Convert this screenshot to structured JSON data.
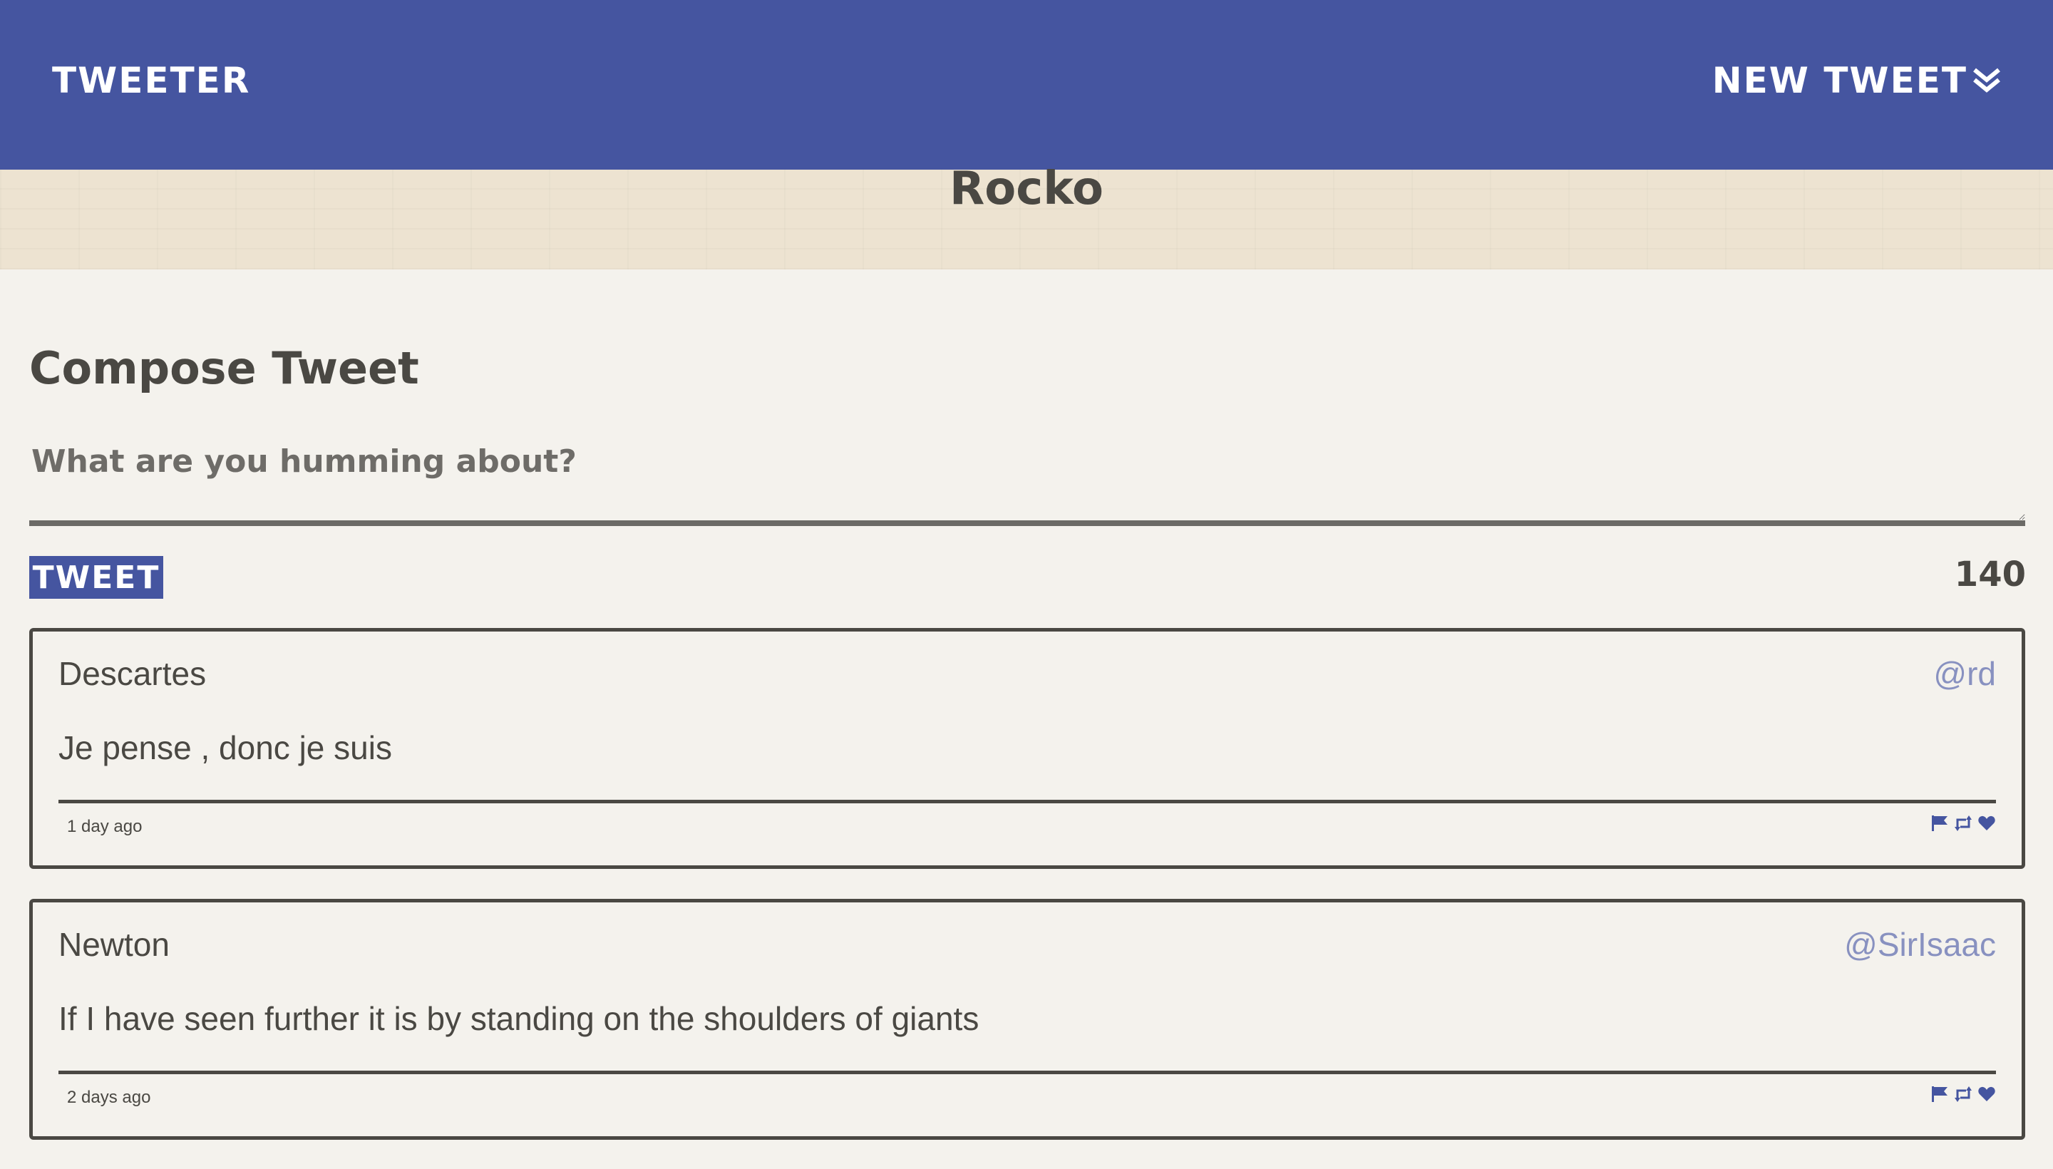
{
  "navbar": {
    "brand": "TWEETER",
    "new_tweet_label": "NEW TWEET",
    "new_tweet_icon": "double-chevron-down-icon"
  },
  "profile": {
    "name": "Rocko"
  },
  "compose": {
    "title": "Compose Tweet",
    "placeholder": "What are you humming about?",
    "submit_label": "TWEET",
    "char_counter": "140"
  },
  "tweets": [
    {
      "name": "Descartes",
      "handle": "@rd",
      "content": "Je pense , donc je suis",
      "time": "1 day ago",
      "actions": [
        "flag-icon",
        "retweet-icon",
        "heart-icon"
      ]
    },
    {
      "name": "Newton",
      "handle": "@SirIsaac",
      "content": "If I have seen further it is by standing on the shoulders of giants",
      "time": "2 days ago",
      "actions": [
        "flag-icon",
        "retweet-icon",
        "heart-icon"
      ]
    }
  ],
  "colors": {
    "accent": "#4555a0",
    "background": "#f4f2ed",
    "banner": "#ede3d1",
    "text": "#4a4843",
    "handle": "#8891c0"
  }
}
